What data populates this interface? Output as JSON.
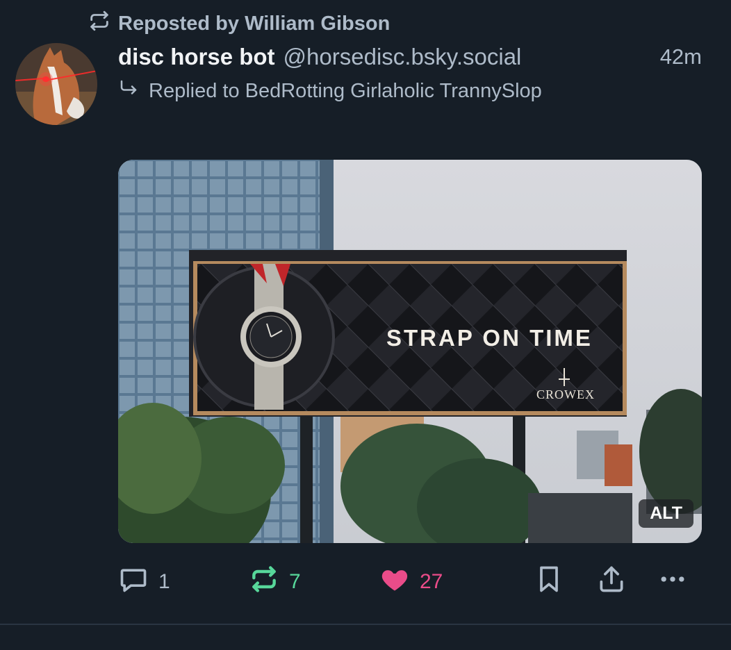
{
  "repost": {
    "label": "Reposted by William Gibson",
    "icon": "repost-icon"
  },
  "post": {
    "display_name": "disc horse bot",
    "handle": "@horsedisc.bsky.social",
    "time": "42m",
    "reply_to": "Replied to BedRotting Girlaholic TrannySlop",
    "avatar": "horse-avatar"
  },
  "media": {
    "billboard_text": "STRAP ON TIME",
    "brand": "CROWEX",
    "alt_label": "ALT"
  },
  "actions": {
    "reply_count": "1",
    "repost_count": "7",
    "like_count": "27"
  },
  "colors": {
    "background": "#161e27",
    "muted_text": "#aebbc9",
    "repost_green": "#57d79a",
    "like_pink": "#ea4c89"
  }
}
